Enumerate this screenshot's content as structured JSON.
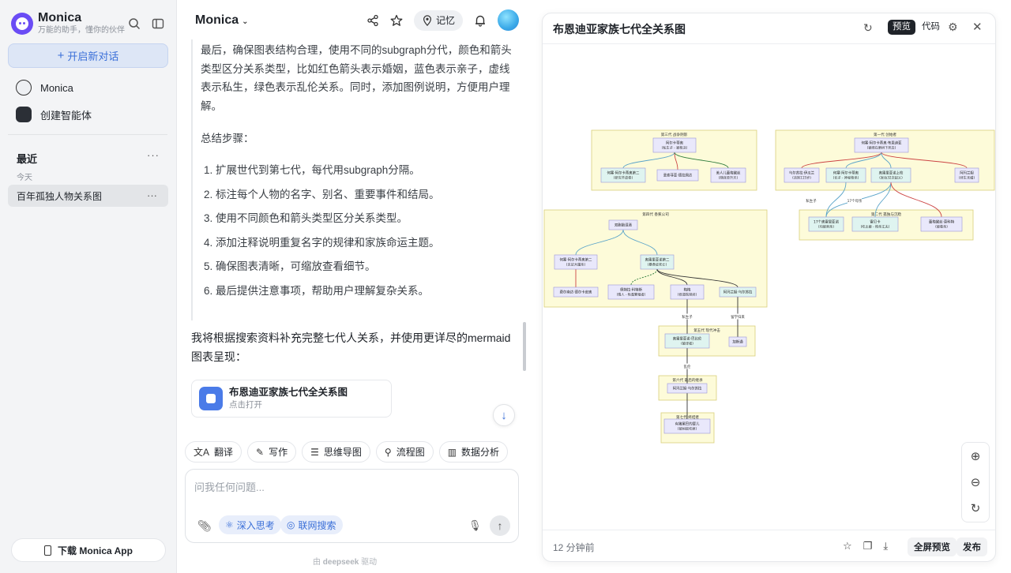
{
  "sidebar": {
    "brand_name": "Monica",
    "brand_tagline": "万能的助手，懂你的伙伴",
    "new_chat": "开启新对话",
    "items": [
      {
        "label": "Monica"
      },
      {
        "label": "创建智能体"
      }
    ],
    "recent_title": "最近",
    "more": "···",
    "day_label": "今天",
    "history": [
      {
        "label": "百年孤独人物关系图"
      }
    ],
    "download_label": "下载 Monica App"
  },
  "chat": {
    "model_label": "Monica",
    "memory_label": "记忆",
    "thinking_para1": "最后，确保图表结构合理，使用不同的subgraph分代，颜色和箭头类型区分关系类型，比如红色箭头表示婚姻，蓝色表示亲子，虚线表示私生，绿色表示乱伦关系。同时，添加图例说明，方便用户理解。",
    "thinking_para2": "总结步骤：",
    "steps": [
      "扩展世代到第七代，每代用subgraph分隔。",
      "标注每个人物的名字、别名、重要事件和结局。",
      "使用不同颜色和箭头类型区分关系类型。",
      "添加注释说明重复名字的规律和家族命运主题。",
      "确保图表清晰，可缩放查看细节。",
      "最后提供注意事项，帮助用户理解复杂关系。"
    ],
    "reply": "我将根据搜索资料补充完整七代人关系，并使用更详尽的mermaid图表呈现：",
    "card_title": "布恩迪亚家族七代全关系图",
    "card_sub": "点击打开",
    "tools": [
      "翻译",
      "写作",
      "思维导图",
      "流程图",
      "数据分析"
    ],
    "input_placeholder": "问我任何问题...",
    "chip_think": "深入思考",
    "chip_search": "联网搜索",
    "powered_prefix": "由",
    "powered_name": "deepseek",
    "powered_suffix": "驱动"
  },
  "panel": {
    "title": "布恩迪亚家族七代全关系图",
    "tab_preview": "预览",
    "tab_code": "代码",
    "time": "12 分钟前",
    "fullscreen": "全屏预览",
    "publish": "发布"
  },
  "diagram": {
    "groups": [
      {
        "label": "第三代 战争阴影"
      },
      {
        "label": "第一代 创始者"
      },
      {
        "label": "第四代 香蕉公司"
      },
      {
        "label": "第二代 孤独与沉稳"
      },
      {
        "label": "第五代 现代冲击"
      },
      {
        "label": "第六代 最后的继承"
      },
      {
        "label": "第七代 终结者"
      }
    ],
    "nodes": [
      {
        "text": "阿尔卡蒂奥",
        "sub": "(私生子 - 被枪决)"
      },
      {
        "text": "何塞·阿尔卡蒂奥第二",
        "sub": "(研究羊皮卷)"
      },
      {
        "text": "圣索菲亚·德拉佩达",
        "sub": ""
      },
      {
        "text": "美人儿蕾梅黛丝",
        "sub": "(随床单升天)"
      },
      {
        "text": "何塞·阿尔卡蒂奥·布恩迪亚",
        "sub": "(被绑在栗树下死去)"
      },
      {
        "text": "乌尔苏拉·伊瓜兰",
        "sub": "(活到115岁)"
      },
      {
        "text": "何塞·阿尔卡蒂奥",
        "sub": "(长子 - 神秘枪杀)"
      },
      {
        "text": "奥雷里亚诺上校",
        "sub": "(发动32次起义)"
      },
      {
        "text": "阿玛兰妲",
        "sub": "(终生未婚)"
      },
      {
        "text": "17个奥雷里亚诺",
        "sub": "(均被刺杀)"
      },
      {
        "text": "雷贝卡",
        "sub": "(吃土癖 - 枪杀丈夫)"
      },
      {
        "text": "蕾梅黛丝·莫科特",
        "sub": "(被毒杀)"
      },
      {
        "text": "双胞胎混淆",
        "sub": ""
      },
      {
        "text": "何塞·阿尔卡蒂奥第二",
        "sub": "(见证大屠杀)"
      },
      {
        "text": "奥雷里亚诺第二",
        "sub": "(暴食症死亡)"
      },
      {
        "text": "费尔南达·德尔卡皮奥",
        "sub": ""
      },
      {
        "text": "佩特拉·科特斯",
        "sub": "(情人 - 牲畜繁殖者)"
      },
      {
        "text": "梅梅",
        "sub": "(修道院禁闭)"
      },
      {
        "text": "阿玛兰妲·乌尔苏拉",
        "sub": ""
      },
      {
        "text": "奥雷里亚诺·巴比伦",
        "sub": "(破译者)"
      },
      {
        "text": "加斯通",
        "sub": ""
      },
      {
        "text": "阿玛兰妲·乌尔苏拉",
        "sub": ""
      },
      {
        "text": "有猪尾巴的婴儿",
        "sub": "(被蚂蚁吃掉)"
      }
    ],
    "edge_labels": [
      "私生子",
      "17个母亲",
      "私生子",
      "留学归来",
      "乱伦"
    ]
  }
}
